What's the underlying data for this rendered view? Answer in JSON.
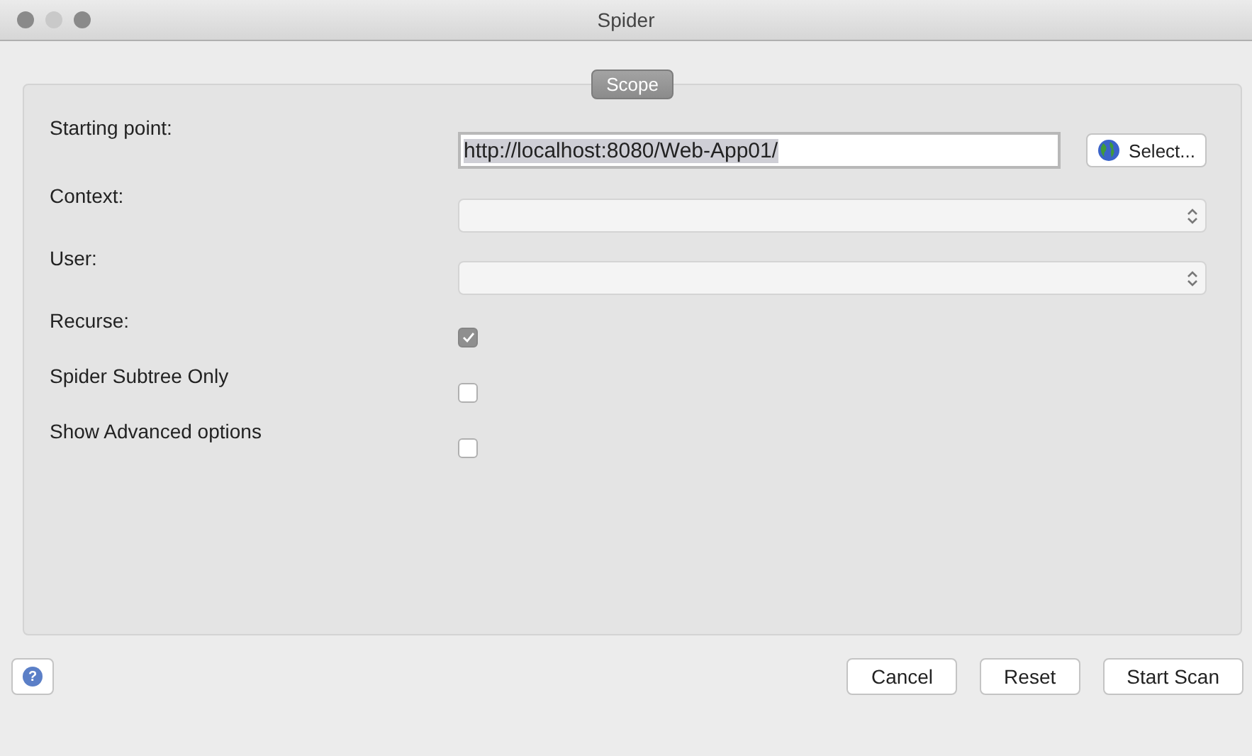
{
  "window": {
    "title": "Spider"
  },
  "tabs": [
    {
      "label": "Scope",
      "selected": true
    }
  ],
  "fields": [
    {
      "kind": "text",
      "label": "Starting point:",
      "value": "http://localhost:8080/Web-App01/",
      "button": "Select..."
    },
    {
      "kind": "combo",
      "label": "Context:"
    },
    {
      "kind": "combo",
      "label": "User:"
    },
    {
      "kind": "checkbox",
      "label": "Recurse:",
      "checked": true
    },
    {
      "kind": "checkbox",
      "label": "Spider Subtree Only",
      "checked": false
    },
    {
      "kind": "checkbox",
      "label": "Show Advanced options",
      "checked": false
    }
  ],
  "help_button": {
    "label": "?"
  },
  "buttons": [
    "Cancel",
    "Reset",
    "Start Scan"
  ]
}
